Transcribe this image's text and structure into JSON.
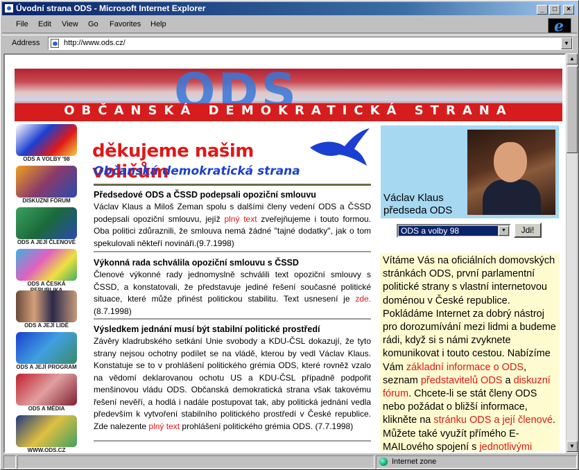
{
  "window": {
    "title": "Úvodní strana ODS - Microsoft Internet Explorer",
    "min": "_",
    "max": "□",
    "close": "×"
  },
  "menu": {
    "file": "File",
    "edit": "Edit",
    "view": "View",
    "go": "Go",
    "favorites": "Favorites",
    "help": "Help"
  },
  "address": {
    "label": "Address",
    "url": "http://www.ods.cz/"
  },
  "banner": {
    "logo": "ODS",
    "subtitle": "OBČANSKÁ DEMOKRATICKÁ STRANA"
  },
  "nav": [
    {
      "label": "ODS A VOLBY '98"
    },
    {
      "label": "DISKUZNÍ FÓRUM"
    },
    {
      "label": "ODS A JEJÍ ČLENOVÉ"
    },
    {
      "label": "ODS A ČESKÁ REPUBLIKA"
    },
    {
      "label": "ODS A JEJÍ LIDÉ"
    },
    {
      "label": "ODS A JEJÍ PROGRAM"
    },
    {
      "label": "ODS A MÉDIA"
    },
    {
      "label": "WWW.ODS.CZ"
    }
  ],
  "header": {
    "thanks": "děkujeme našim voličům",
    "tagline": "Občanská demokratická strana"
  },
  "articles": [
    {
      "title": "Předsedové ODS a ČSSD podepsali opoziční smlouvu",
      "text1": "Václav Klaus a Miloš Zeman spolu s dalšími členy vedení ODS a ČSSD podepsali opoziční smlouvu, jejíž ",
      "link": "plný text",
      "text2": " zveřejňujeme i touto formou. Oba politici zdůraznili, že smlouva nemá žádné \"tajné dodatky\", jak o tom spekulovali někteří novináři.(9.7.1998)"
    },
    {
      "title": "Výkonná rada schválila opoziční smlouvu s ČSSD",
      "text1": "Členové výkonné rady jednomyslně schválili text opoziční smlouvy s ČSSD, a konstatovali, že představuje jediné řešení současné politické situace, které může přinést politickou stabilitu. Text usnesení je ",
      "link": "zde.",
      "text2": "(8.7.1998)"
    },
    {
      "title": "Výsledkem jednání musí být stabilní politické prostředí",
      "text1": "Závěry kladrubského setkání Unie svobody a KDU-ČSL dokazují, že tyto strany nejsou ochotny podílet se na vládě, kterou by vedl Václav Klaus. Konstatuje se to v prohlášení politického grémia ODS, které rovněž vzalo na vědomí deklarovanou ochotu US a KDU-ČSL případně podpořit menšinovou vládu ODS. Občanská demokratická strana však takovému řešení nevěří, a hodlá i nadále postupovat tak, aby politická jednání vedla především k vytvoření stabilního politického prostředí v České republice. Zde nalezente ",
      "link": "plný text",
      "text2": " prohlášení politického grémia ODS. (7.7.1998)"
    }
  ],
  "president": {
    "name": "Václav Klaus",
    "role": "předseda ODS"
  },
  "select": {
    "value": "ODS a volby 98",
    "button": "Jdi!"
  },
  "welcome": {
    "p1": "Vítáme Vás na oficiálních domovských stránkách ODS, první parlamentní politické strany s vlastní internetovou doménou v České republice. Pokládáme Internet za dobrý nástroj pro dorozumívání mezi lidmi a budeme rádi, když si s námi zvyknete komunikovat i touto cestou. Nabízíme Vám ",
    "l1": "základní informace o ODS",
    "p2": ", seznam ",
    "l2": "představitelů ODS",
    "p3": " a ",
    "l3": "diskuzní fórum",
    "p4": ". Chcete-li se stát členy ODS nebo požádat o bližší informace, klikněte na ",
    "l4": "stránku ODS a její členové",
    "p5": ". Můžete také využít přímého E-MAILového spojení s ",
    "l5": "jednotlivými představiteli"
  },
  "status": {
    "zone": "Internet zone"
  },
  "colors": {
    "accent_red": "#e01818",
    "link_blue": "#1a3fd0",
    "president_bg": "#a6d8f2",
    "welcome_bg": "#fffbd0"
  }
}
